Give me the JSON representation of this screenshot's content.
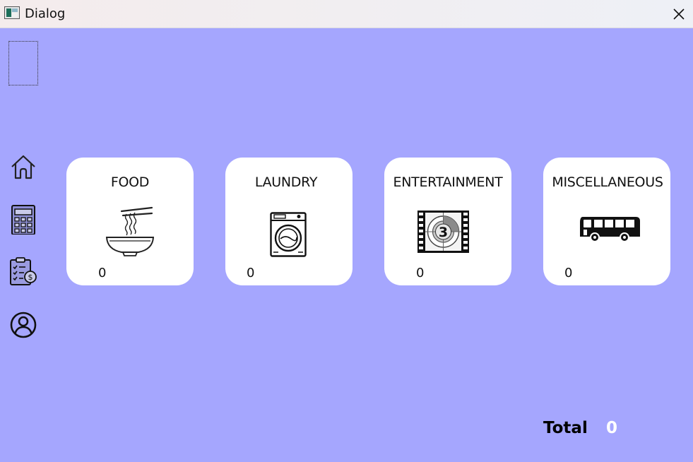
{
  "window": {
    "title": "Dialog"
  },
  "sidebar": {
    "items": [
      {
        "name": "home",
        "icon": "home-icon"
      },
      {
        "name": "calculator",
        "icon": "calculator-icon"
      },
      {
        "name": "expense-list",
        "icon": "clipboard-dollar-icon"
      },
      {
        "name": "profile",
        "icon": "user-circle-icon"
      }
    ]
  },
  "categories": [
    {
      "title": "FOOD",
      "icon": "noodle-bowl-icon",
      "value": "0"
    },
    {
      "title": "LAUNDRY",
      "icon": "washing-machine-icon",
      "value": "0"
    },
    {
      "title": "ENTERTAINMENT",
      "icon": "film-countdown-icon",
      "value": "0"
    },
    {
      "title": "MISCELLANEOUS",
      "icon": "bus-icon",
      "value": "0"
    }
  ],
  "total": {
    "label": "Total",
    "value": "0"
  },
  "colors": {
    "background": "#a5a6fe",
    "card": "#ffffff",
    "total_value": "#ffffff"
  }
}
